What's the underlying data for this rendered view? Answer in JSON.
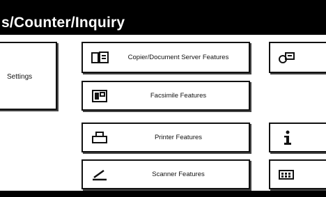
{
  "window": {
    "title": "s/Counter/Inquiry"
  },
  "left_panel": {
    "settings_label": "Settings"
  },
  "buttons": {
    "copier": {
      "label": "Copier/Document Server Features",
      "icon": "copier-icon"
    },
    "facsimile": {
      "label": "Facsimile Features",
      "icon": "facsimile-icon"
    },
    "printer": {
      "label": "Printer Features",
      "icon": "printer-icon"
    },
    "scanner": {
      "label": "Scanner Features",
      "icon": "scanner-icon"
    }
  },
  "right_buttons": {
    "top": {
      "icon": "counter-icon"
    },
    "info": {
      "icon": "info-icon"
    },
    "bottom": {
      "icon": "keypad-icon"
    }
  }
}
